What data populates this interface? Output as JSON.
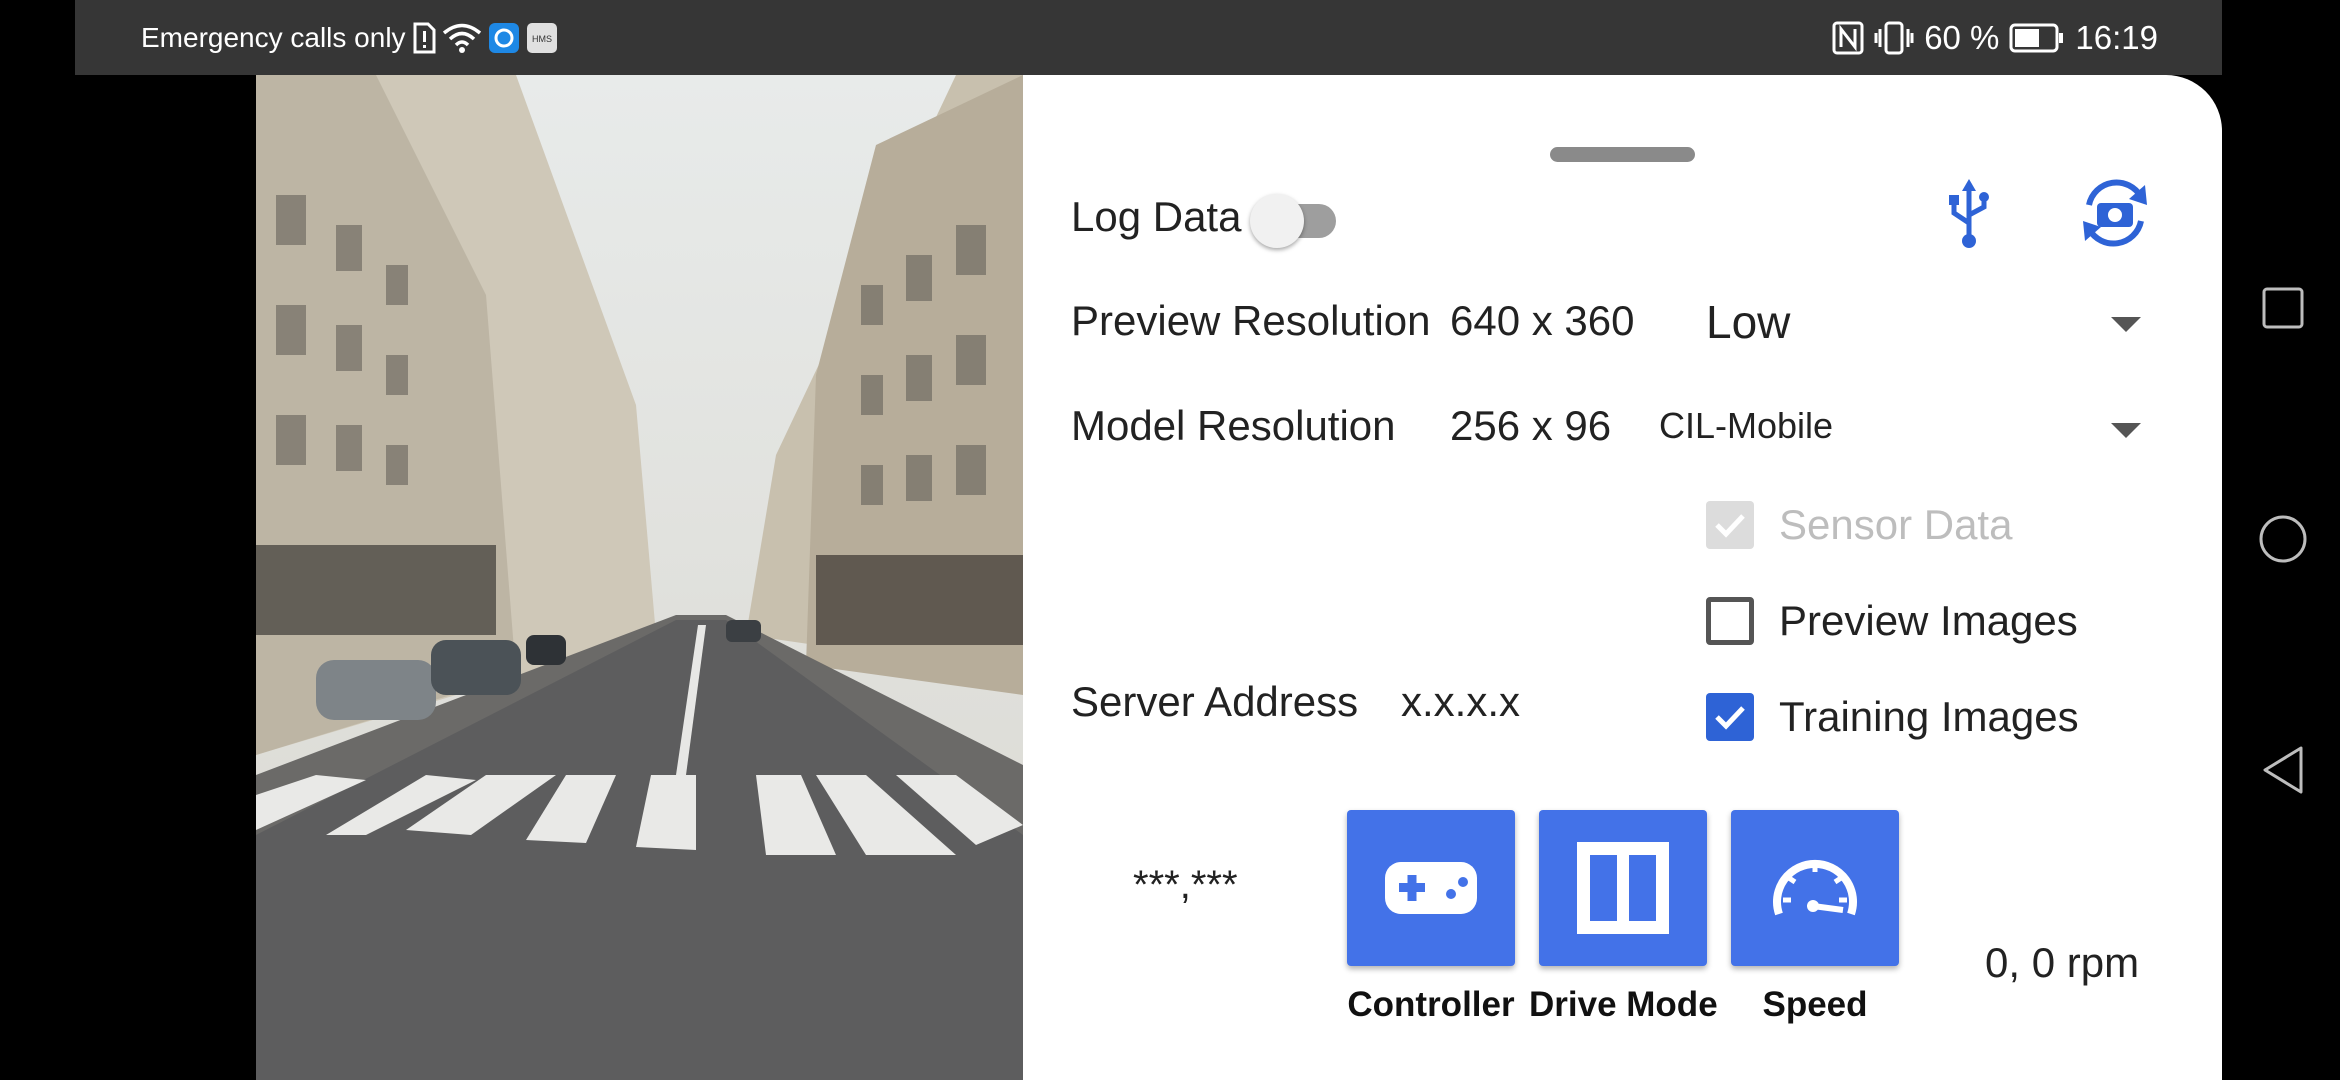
{
  "status_bar": {
    "carrier_text": "Emergency calls only",
    "battery_text": "60 %",
    "time": "16:19",
    "icons": [
      "sim-alert-icon",
      "wifi-icon",
      "app-icon",
      "hms-icon",
      "nfc-icon",
      "vibrate-icon",
      "battery-icon"
    ]
  },
  "panel": {
    "log_data_label": "Log Data",
    "log_data_on": false,
    "preview_resolution_label": "Preview Resolution",
    "preview_resolution_value": "640 x 360",
    "preview_quality": "Low",
    "model_resolution_label": "Model Resolution",
    "model_resolution_value": "256 x 96",
    "model_name": "CIL-Mobile",
    "server_address_label": "Server Address",
    "server_address_value": "x.x.x.x",
    "checkboxes": [
      {
        "label": "Sensor Data",
        "checked": true,
        "enabled": false
      },
      {
        "label": "Preview Images",
        "checked": false,
        "enabled": true
      },
      {
        "label": "Training Images",
        "checked": true,
        "enabled": true
      }
    ],
    "control_readout": "***,***",
    "rpm_readout": "0,  0 rpm",
    "buttons": {
      "controller": "Controller",
      "drive_mode": "Drive Mode",
      "speed": "Speed"
    },
    "accent_color": "#4372E8"
  }
}
